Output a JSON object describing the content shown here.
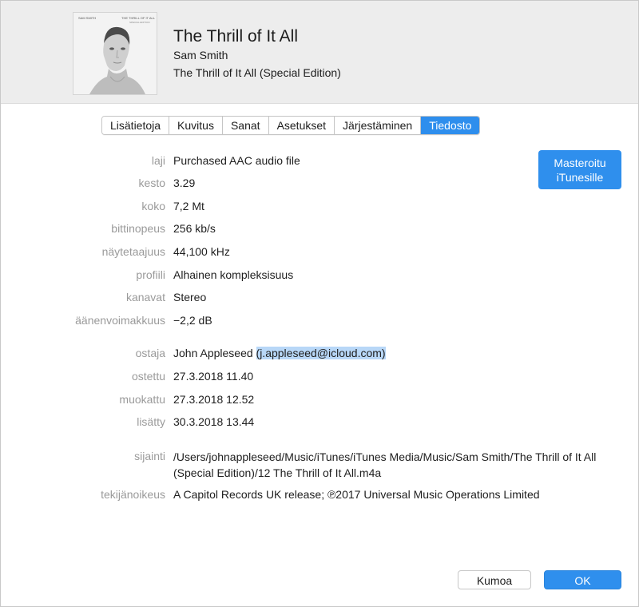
{
  "header": {
    "title": "The Thrill of It All",
    "artist": "Sam Smith",
    "album": "The Thrill of It All (Special Edition)",
    "art_text_left": "SAM SMITH",
    "art_text_right": "THE THRILL OF IT ALL",
    "art_text_right2": "SPECIAL EDITION"
  },
  "tabs": [
    {
      "label": "Lisätietoja",
      "active": false
    },
    {
      "label": "Kuvitus",
      "active": false
    },
    {
      "label": "Sanat",
      "active": false
    },
    {
      "label": "Asetukset",
      "active": false
    },
    {
      "label": "Järjestäminen",
      "active": false
    },
    {
      "label": "Tiedosto",
      "active": true
    }
  ],
  "file_info": {
    "kind": {
      "label": "laji",
      "value": "Purchased AAC audio file"
    },
    "duration": {
      "label": "kesto",
      "value": "3.29"
    },
    "size": {
      "label": "koko",
      "value": "7,2 Mt"
    },
    "bitrate": {
      "label": "bittinopeus",
      "value": "256 kb/s"
    },
    "sample_rate": {
      "label": "näytetaajuus",
      "value": "44,100 kHz"
    },
    "profile": {
      "label": "profiili",
      "value": "Alhainen kompleksisuus"
    },
    "channels": {
      "label": "kanavat",
      "value": "Stereo"
    },
    "volume": {
      "label": "äänenvoimakkuus",
      "value": "−2,2 dB"
    }
  },
  "purchase_info": {
    "buyer": {
      "label": "ostaja",
      "name": "John Appleseed",
      "email": "(j.appleseed@icloud.com)"
    },
    "purchased": {
      "label": "ostettu",
      "value": "27.3.2018 11.40"
    },
    "modified": {
      "label": "muokattu",
      "value": "27.3.2018 12.52"
    },
    "added": {
      "label": "lisätty",
      "value": "30.3.2018 13.44"
    }
  },
  "location": {
    "label": "sijainti",
    "value": "/Users/johnappleseed/Music/iTunes/iTunes Media/Music/Sam Smith/The Thrill of It All (Special Edition)/12 The Thrill of It All.m4a"
  },
  "copyright": {
    "label": "tekijänoikeus",
    "value": "A Capitol Records UK release; ℗2017 Universal Music Operations Limited"
  },
  "master_button": {
    "line1": "Masteroitu",
    "line2": "iTunesille"
  },
  "buttons": {
    "cancel": "Kumoa",
    "ok": "OK"
  },
  "colors": {
    "accent": "#2f8fed",
    "highlight": "#b8d7f7",
    "header_bg": "#ededed",
    "label_gray": "#9a9a9a"
  }
}
